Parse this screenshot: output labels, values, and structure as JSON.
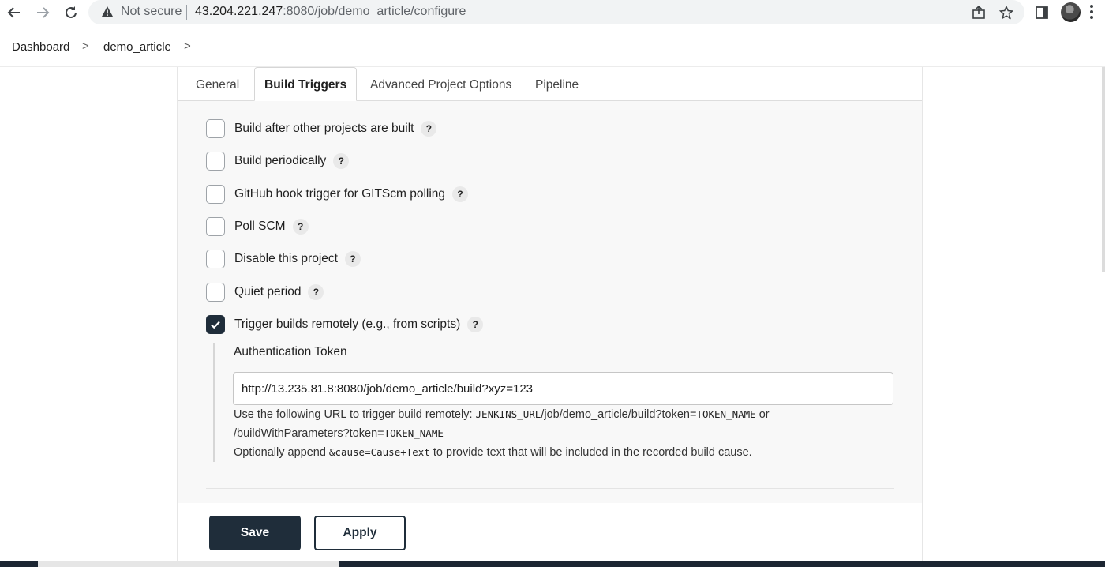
{
  "browser": {
    "security_label": "Not secure",
    "url_host": "43.204.221.247",
    "url_path": ":8080/job/demo_article/configure",
    "icons": [
      "back-icon",
      "forward-icon",
      "reload-icon",
      "warning-icon",
      "share-icon",
      "star-icon",
      "side-panel-icon",
      "avatar",
      "menu-icon"
    ]
  },
  "breadcrumb": {
    "items": [
      "Dashboard",
      "demo_article"
    ],
    "separator": ">"
  },
  "tabs": [
    {
      "label": "General",
      "active": false
    },
    {
      "label": "Build Triggers",
      "active": true
    },
    {
      "label": "Advanced Project Options",
      "active": false
    },
    {
      "label": "Pipeline",
      "active": false
    }
  ],
  "triggers": [
    {
      "label": "Build after other projects are built",
      "checked": false
    },
    {
      "label": "Build periodically",
      "checked": false
    },
    {
      "label": "GitHub hook trigger for GITScm polling",
      "checked": false
    },
    {
      "label": "Poll SCM",
      "checked": false
    },
    {
      "label": "Disable this project",
      "checked": false
    },
    {
      "label": "Quiet period",
      "checked": false
    },
    {
      "label": "Trigger builds remotely (e.g., from scripts)",
      "checked": true
    }
  ],
  "help_glyph": "?",
  "auth": {
    "label": "Authentication Token",
    "value": "http://13.235.81.8:8080/job/demo_article/build?xyz=123",
    "hint_prefix": "Use the following URL to trigger build remotely: ",
    "hint_code1": "JENKINS_URL",
    "hint_mid1": "/job/demo_article/build?token=",
    "hint_code2": "TOKEN_NAME",
    "hint_or": " or",
    "hint_line2_a": "/buildWithParameters?token=",
    "hint_line2_code": "TOKEN_NAME",
    "hint_line3_a": "Optionally append ",
    "hint_line3_code": "&cause=Cause+Text",
    "hint_line3_b": " to provide text that will be included in the recorded build cause."
  },
  "actions": {
    "save": "Save",
    "apply": "Apply"
  },
  "colors": {
    "primary": "#1f2d3a",
    "panel_bg": "#f8f8f8"
  }
}
